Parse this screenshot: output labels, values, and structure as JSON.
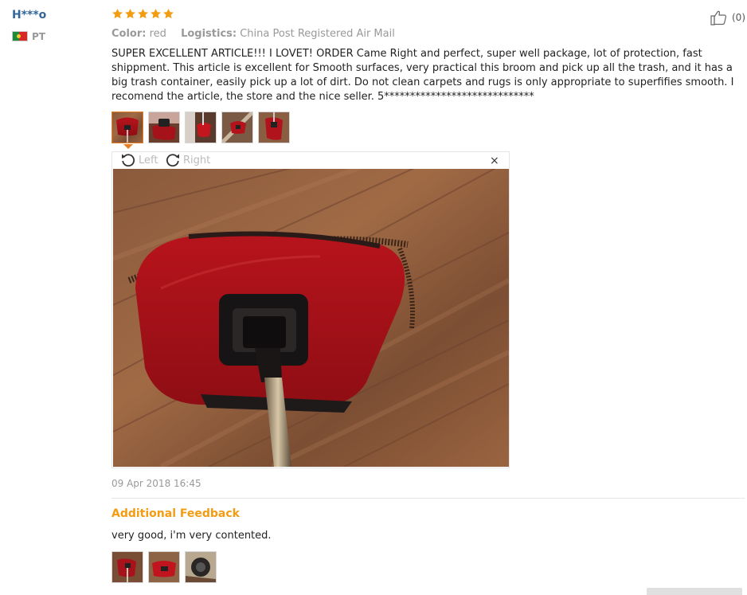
{
  "user": {
    "name": "H***o",
    "country": "PT",
    "flag_icon": "portugal-flag-icon"
  },
  "rating": {
    "stars": 5,
    "max": 5,
    "star_color": "#f39c12"
  },
  "helpful": {
    "icon": "thumbs-up-icon",
    "count": "(0)"
  },
  "attributes": {
    "color_label": "Color:",
    "color_value": "red",
    "logistics_label": "Logistics:",
    "logistics_value": "China Post Registered Air Mail"
  },
  "review_text": "SUPER EXCELLENT ARTICLE!!! I LOVET! ORDER Came Right and perfect, super well package, lot of protection, fast shippment. This article is excellent for Smooth surfaces, very practical this broom and pick up all the trash, and it has a big trash container, easily pick up a lot of dirt. Do not clean carpets and rugs is only appropriate to superfifies smooth. I recomend the article, the store and the nice seller. 5*****************************",
  "photos": {
    "count": 5,
    "active_index": 0
  },
  "viewer": {
    "rotate_left_label": "Left",
    "rotate_right_label": "Right",
    "close_label": "×",
    "rotate_left_icon": "rotate-left-icon",
    "rotate_right_icon": "rotate-right-icon"
  },
  "date": "09 Apr 2018 16:45",
  "additional_feedback": {
    "title": "Additional Feedback",
    "text": "very good, i'm very contented.",
    "photo_count": 3
  },
  "colors": {
    "link": "#336699",
    "accent": "#f39c12",
    "active_border": "#e67e22",
    "muted": "#999999"
  }
}
